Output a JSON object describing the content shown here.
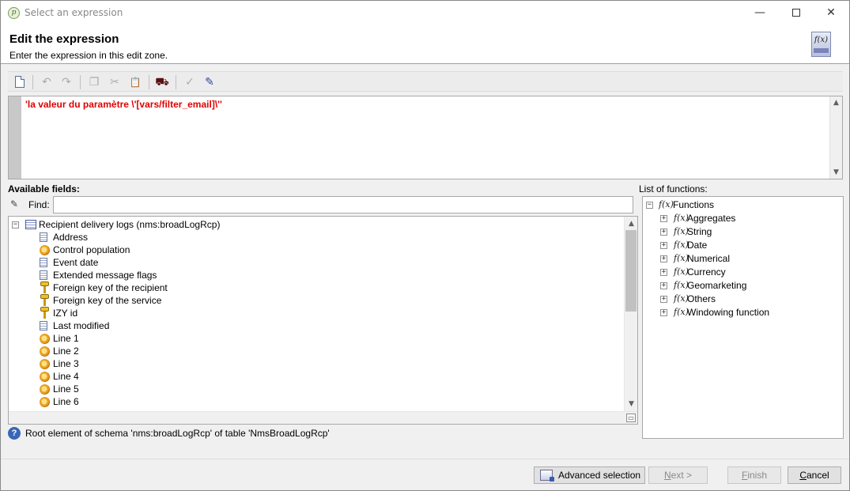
{
  "window": {
    "title": "Select an expression",
    "controls": {
      "minimize": "—",
      "close": "✕"
    }
  },
  "header": {
    "title": "Edit the expression",
    "subtitle": "Enter the expression in this edit zone.",
    "icon_label": "f(x)"
  },
  "toolbar": {
    "icons": [
      "new-document-icon",
      "undo-icon",
      "redo-icon",
      "copy-icon",
      "cut-icon",
      "paste-icon",
      "find-binoculars-icon",
      "check-icon",
      "edit-icon"
    ],
    "glyphs": {
      "undo": "↶",
      "redo": "↷",
      "copy": "❐",
      "cut": "✂",
      "paste": "📋",
      "find": "⛟",
      "check": "✓",
      "edit": "✎"
    }
  },
  "editor": {
    "expression": "'la valeur du paramètre \\'[vars/filter_email]\\''",
    "scroll_up": "▲",
    "scroll_down": "▼"
  },
  "fields": {
    "label": "Available fields:",
    "find_label": "Find:",
    "find_value": "",
    "root": {
      "label": "Recipient delivery logs (nms:broadLogRcp)",
      "expander": "−"
    },
    "items": [
      {
        "label": "Address",
        "icon": "calculated-field-icon"
      },
      {
        "label": "Control population",
        "icon": "enum-gear-icon"
      },
      {
        "label": "Event date",
        "icon": "calculated-field-icon"
      },
      {
        "label": "Extended message flags",
        "icon": "calculated-field-icon"
      },
      {
        "label": "Foreign key of the recipient",
        "icon": "key-icon"
      },
      {
        "label": "Foreign key of the service",
        "icon": "key-icon"
      },
      {
        "label": "IZY id",
        "icon": "key-icon"
      },
      {
        "label": "Last modified",
        "icon": "calculated-field-icon"
      },
      {
        "label": "Line 1",
        "icon": "enum-gear-icon"
      },
      {
        "label": "Line 2",
        "icon": "enum-gear-icon"
      },
      {
        "label": "Line 3",
        "icon": "enum-gear-icon"
      },
      {
        "label": "Line 4",
        "icon": "enum-gear-icon"
      },
      {
        "label": "Line 5",
        "icon": "enum-gear-icon"
      },
      {
        "label": "Line 6",
        "icon": "enum-gear-icon"
      }
    ],
    "scroll_up": "▲",
    "scroll_down": "▼"
  },
  "functions": {
    "label": "List of functions:",
    "fx_glyph": "f(x)",
    "root": {
      "label": "Functions",
      "expander": "−"
    },
    "items": [
      {
        "label": "Aggregates",
        "expander": "+"
      },
      {
        "label": "String",
        "expander": "+"
      },
      {
        "label": "Date",
        "expander": "+"
      },
      {
        "label": "Numerical",
        "expander": "+"
      },
      {
        "label": "Currency",
        "expander": "+"
      },
      {
        "label": "Geomarketing",
        "expander": "+"
      },
      {
        "label": "Others",
        "expander": "+"
      },
      {
        "label": "Windowing function",
        "expander": "+"
      }
    ]
  },
  "status": {
    "help_glyph": "?",
    "text": "Root element of schema 'nms:broadLogRcp' of table 'NmsBroadLogRcp'"
  },
  "buttons": {
    "advanced": "Advanced selection",
    "next_underlined": "N",
    "next_rest": "ext >",
    "finish_underlined": "F",
    "finish_rest": "inish",
    "cancel_underlined": "C",
    "cancel_rest": "ancel",
    "enabled": {
      "advanced": true,
      "next": false,
      "finish": false,
      "cancel": true
    }
  },
  "colors": {
    "expression_text": "#e00000",
    "window_bg": "#f0f0f0",
    "help_icon": "#3a66b8"
  }
}
